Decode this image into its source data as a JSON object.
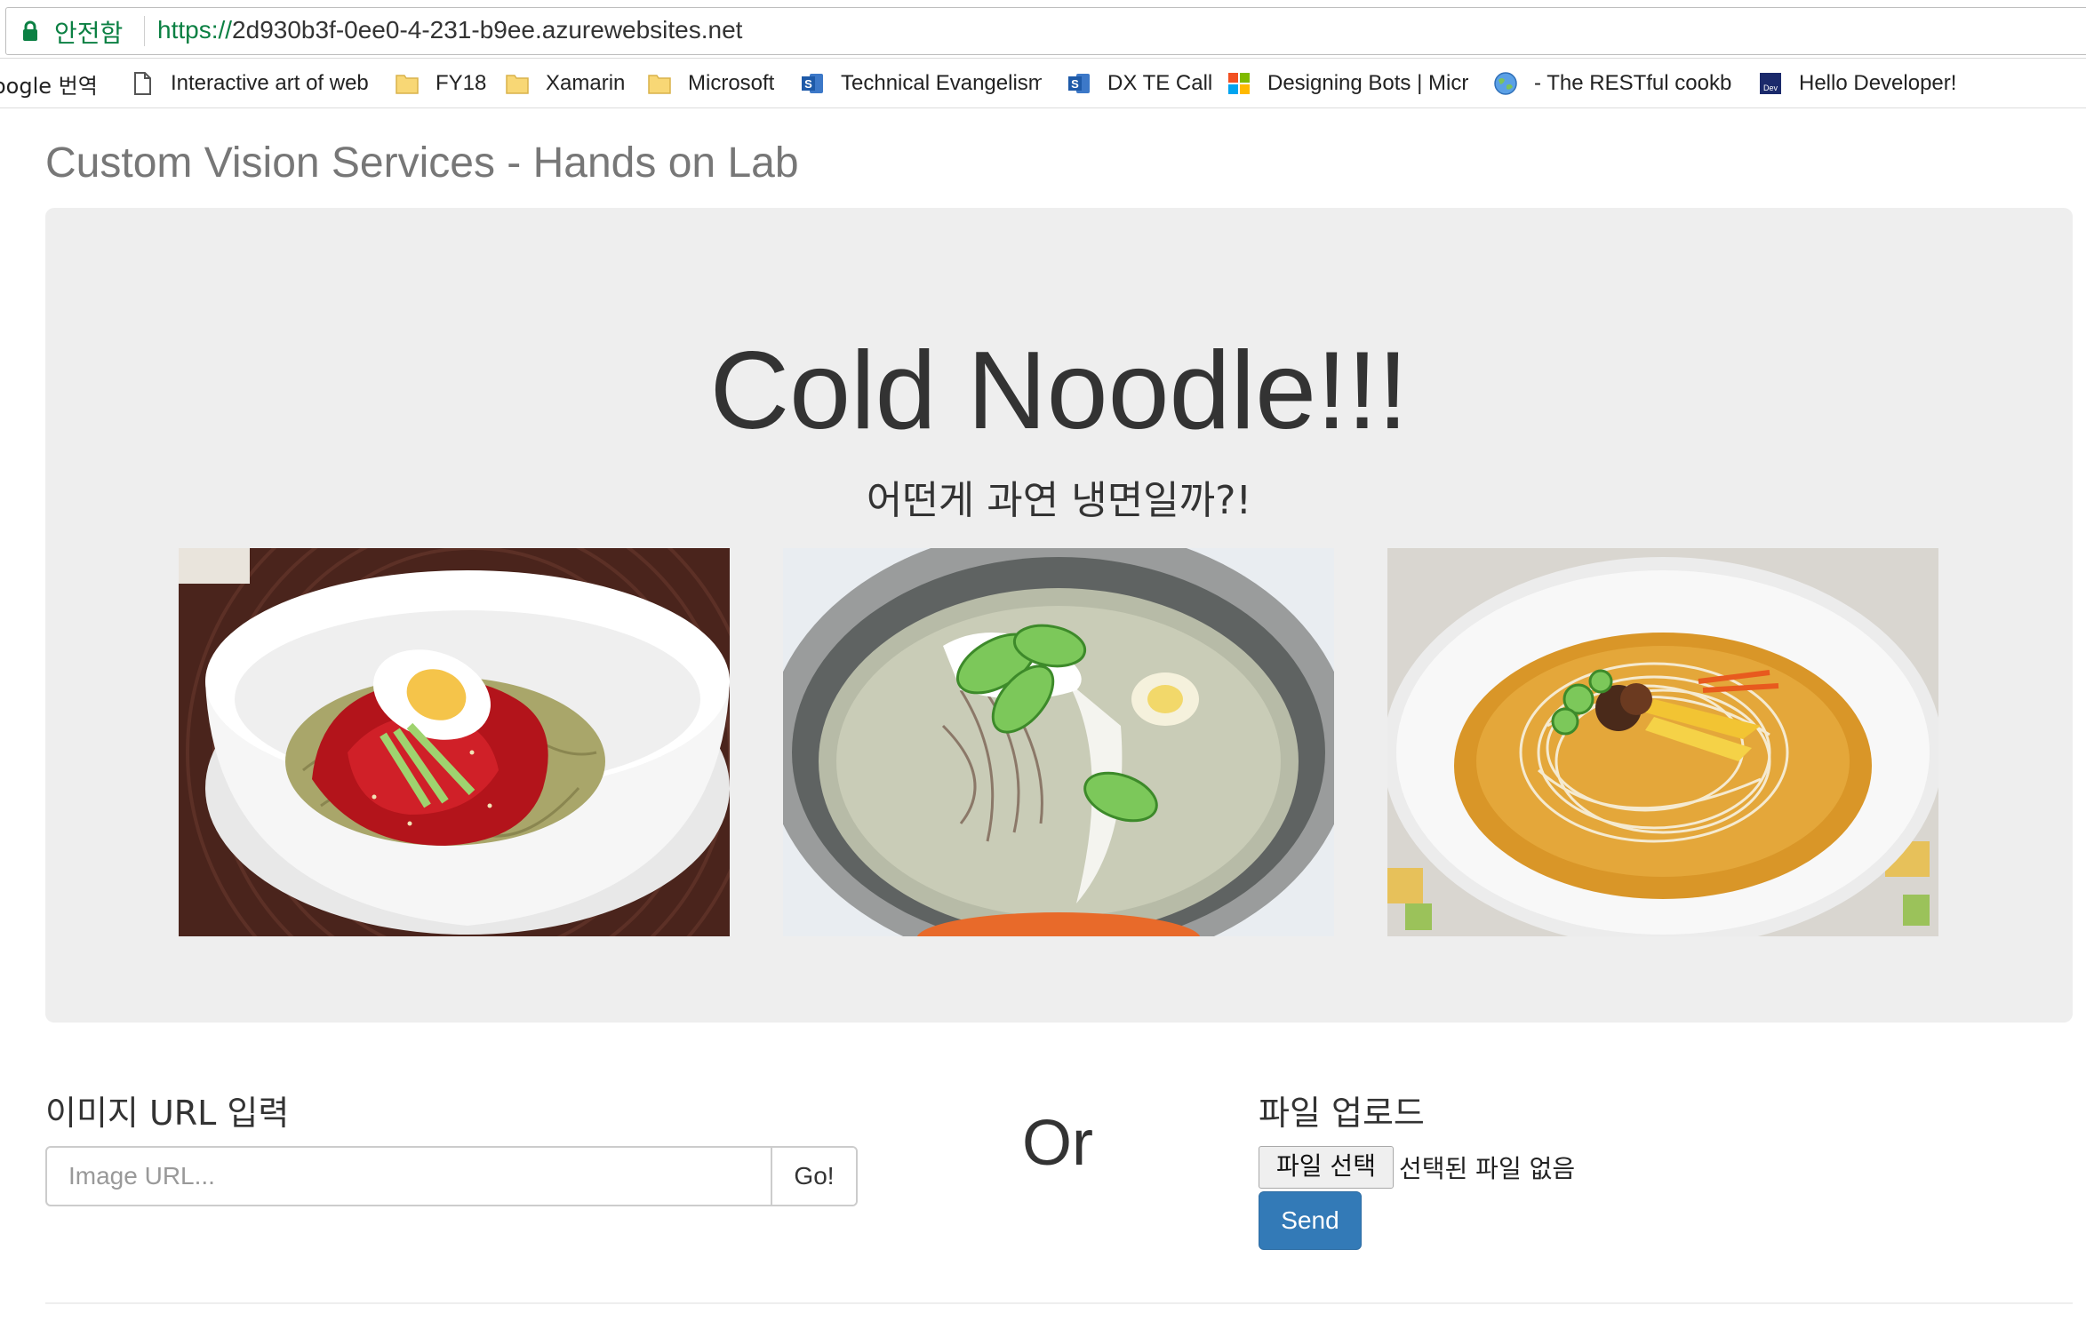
{
  "browser": {
    "secure_label": "안전함",
    "url_scheme": "https://",
    "url_host": "2d930b3f-0ee0-4-231-b9ee.azurewebsites.net",
    "bookmarks": [
      {
        "label": "oogle 번역",
        "icon": "none"
      },
      {
        "label": "Interactive art of web",
        "icon": "page-icon"
      },
      {
        "label": "FY18",
        "icon": "folder-icon"
      },
      {
        "label": "Xamarin",
        "icon": "folder-icon"
      },
      {
        "label": "Microsoft",
        "icon": "folder-icon"
      },
      {
        "label": "Technical Evangelism",
        "icon": "sharepoint-icon"
      },
      {
        "label": "DX TE Call",
        "icon": "sharepoint-icon"
      },
      {
        "label": "Designing Bots | Micr",
        "icon": "microsoft-logo-icon"
      },
      {
        "label": "- The RESTful cookbo",
        "icon": "globe-icon"
      },
      {
        "label": "Hello Developer!",
        "icon": "dev-icon"
      }
    ]
  },
  "page": {
    "site_title": "Custom Vision Services - Hands on Lab",
    "hero": {
      "headline": "Cold Noodle!!!",
      "subhead": "어떤게 과연 냉면일까?!"
    },
    "url_section": {
      "heading": "이미지 URL 입력",
      "input_placeholder": "Image URL...",
      "input_value": "",
      "go_label": "Go!"
    },
    "or_label": "Or",
    "upload_section": {
      "heading": "파일 업로드",
      "choose_label": "파일 선택",
      "status": "선택된 파일 없음",
      "send_label": "Send"
    }
  },
  "colors": {
    "secure_green": "#0b8043",
    "jumbotron_bg": "#eeeeee",
    "primary_button": "#337ab7",
    "title_gray": "#777777"
  }
}
